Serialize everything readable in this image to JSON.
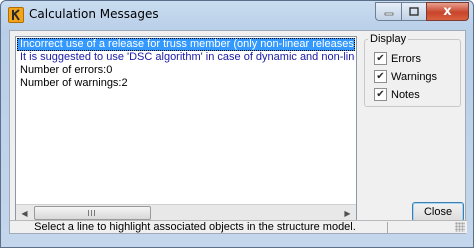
{
  "window": {
    "title": "Calculation Messages",
    "caption": {
      "minimize_icon": "minimize-icon",
      "maximize_icon": "maximize-icon",
      "close_glyph": "x"
    }
  },
  "messages": [
    {
      "text": "Incorrect use of a release for truss member (only non-linear releases for UX d",
      "kind": "error",
      "selected": true
    },
    {
      "text": "It is suggested to use 'DSC algorithm' in case of dynamic and non-linear analys",
      "kind": "note",
      "selected": false
    },
    {
      "text": "Number of errors:0",
      "kind": "info",
      "selected": false
    },
    {
      "text": "Number of warnings:2",
      "kind": "info",
      "selected": false
    }
  ],
  "display": {
    "title": "Display",
    "options": [
      {
        "label": "Errors",
        "checked": true
      },
      {
        "label": "Warnings",
        "checked": true
      },
      {
        "label": "Notes",
        "checked": true
      }
    ]
  },
  "buttons": {
    "close_label": "Close"
  },
  "status": {
    "text": "Select a line to highlight associated objects in the structure model."
  },
  "colors": {
    "selection": "#3399ff",
    "note_text": "#1a1aa8",
    "close_caption": "#c8452c"
  }
}
